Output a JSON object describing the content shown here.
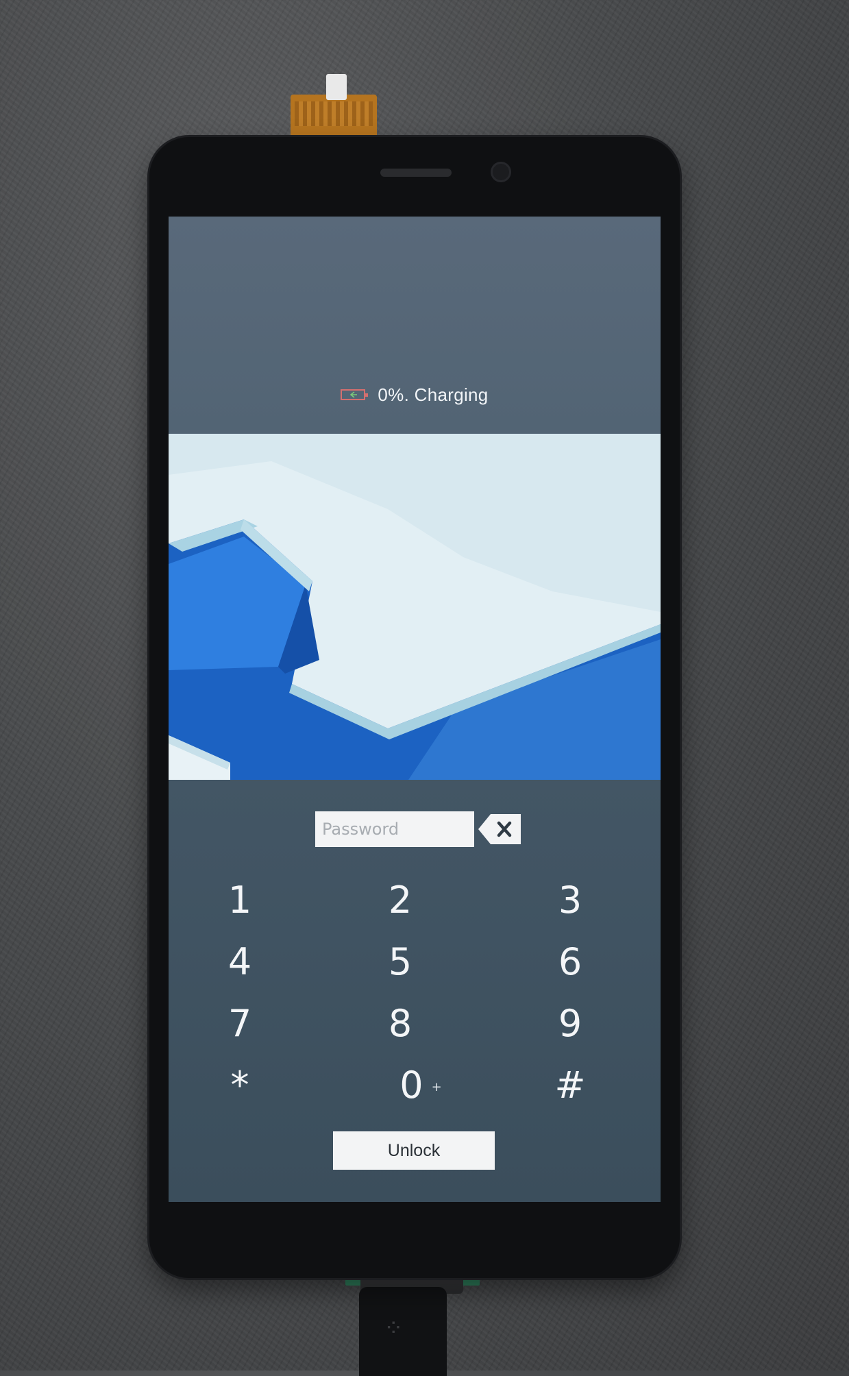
{
  "status": {
    "battery_icon": "battery-charging-icon",
    "battery_percent": 0,
    "text": "0%. Charging"
  },
  "password": {
    "placeholder": "Password",
    "value": "",
    "backspace_icon": "backspace-icon"
  },
  "keypad": {
    "keys": [
      {
        "label": "1",
        "sub": ""
      },
      {
        "label": "2",
        "sub": ""
      },
      {
        "label": "3",
        "sub": ""
      },
      {
        "label": "4",
        "sub": ""
      },
      {
        "label": "5",
        "sub": ""
      },
      {
        "label": "6",
        "sub": ""
      },
      {
        "label": "7",
        "sub": ""
      },
      {
        "label": "8",
        "sub": ""
      },
      {
        "label": "9",
        "sub": ""
      },
      {
        "label": "*",
        "sub": ""
      },
      {
        "label": "0",
        "sub": "+"
      },
      {
        "label": "#",
        "sub": ""
      }
    ]
  },
  "unlock_label": "Unlock",
  "colors": {
    "screen_bg": "#4f6372",
    "wallpaper_blue": "#1f6bc9",
    "wallpaper_white": "#e6f2f6",
    "battery_outline": "#d56f6f"
  }
}
